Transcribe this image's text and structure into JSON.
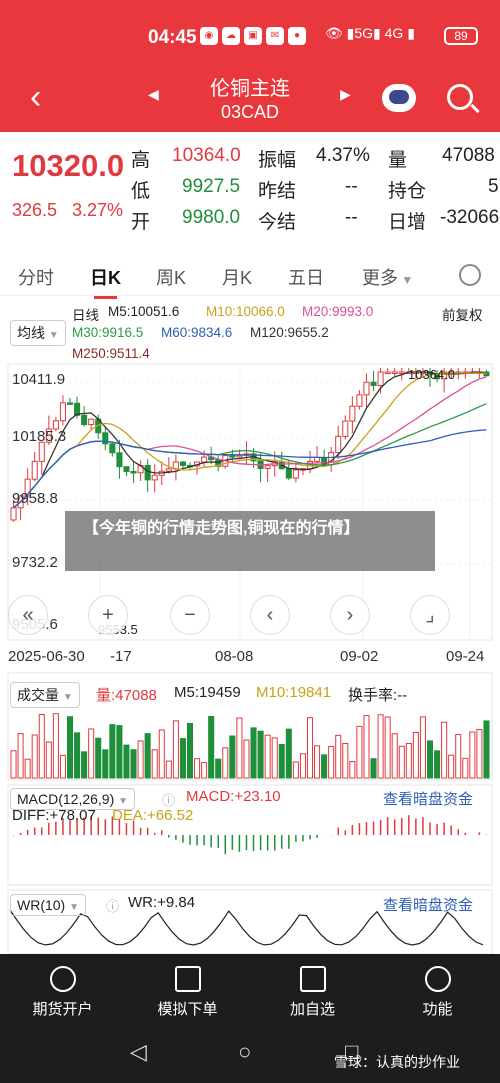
{
  "status": {
    "time": "04:45",
    "signal": "4G",
    "battery": "89"
  },
  "header": {
    "title": "伦铜主连",
    "subtitle": "03CAD"
  },
  "quote": {
    "price": "10320.0",
    "change": "326.5",
    "change_pct": "3.27%",
    "rows": [
      {
        "l1": "高",
        "v1": "10364.0",
        "l2": "振幅",
        "v2": "4.37%",
        "l3": "量",
        "v3": "47088"
      },
      {
        "l1": "低",
        "v1": "9927.5",
        "l2": "昨结",
        "v2": "--",
        "l3": "持仓",
        "v3": "5"
      },
      {
        "l1": "开",
        "v1": "9980.0",
        "l2": "今结",
        "v2": "--",
        "l3": "日增",
        "v3": "-32066"
      }
    ]
  },
  "tabs": [
    "分时",
    "日K",
    "周K",
    "月K",
    "五日",
    "更多"
  ],
  "ma": {
    "selector": "均线",
    "period": "日线",
    "m5": "M5:10051.6",
    "m10": "M10:10066.0",
    "m20": "M20:9993.0",
    "m30": "M30:9916.5",
    "m60": "M60:9834.6",
    "m120": "M120:9655.2",
    "m250": "M250:9511.4",
    "adjust": "前复权"
  },
  "price_chart": {
    "y_labels": [
      "10411.9",
      "10185.3",
      "9958.8",
      "9732.2",
      "9505.6"
    ],
    "high_label": "10364.0",
    "low_label": "9553.5",
    "dates": [
      "2025-06-30",
      "-17",
      "08-08",
      "09-02",
      "09-24"
    ]
  },
  "banner": "【今年铜的行情走势图,铜现在的行情】",
  "volume": {
    "selector": "成交量",
    "qty": "量:47088",
    "m5": "M5:19459",
    "m10": "M10:19841",
    "turnover": "换手率:--"
  },
  "macd": {
    "selector": "MACD(12,26,9)",
    "macd": "MACD:+23.10",
    "diff": "DIFF:+78.07",
    "dea": "DEA:+66.52",
    "link": "查看暗盘资金"
  },
  "wr": {
    "selector": "WR(10)",
    "value": "WR:+9.84",
    "link": "查看暗盘资金"
  },
  "bottom_nav": [
    "期货开户",
    "模拟下单",
    "加自选",
    "功能"
  ],
  "watermark": "雪球：认真的抄作业",
  "colors": {
    "brand": "#e8383d",
    "up": "#e0393e",
    "down": "#1f8f3a"
  }
}
